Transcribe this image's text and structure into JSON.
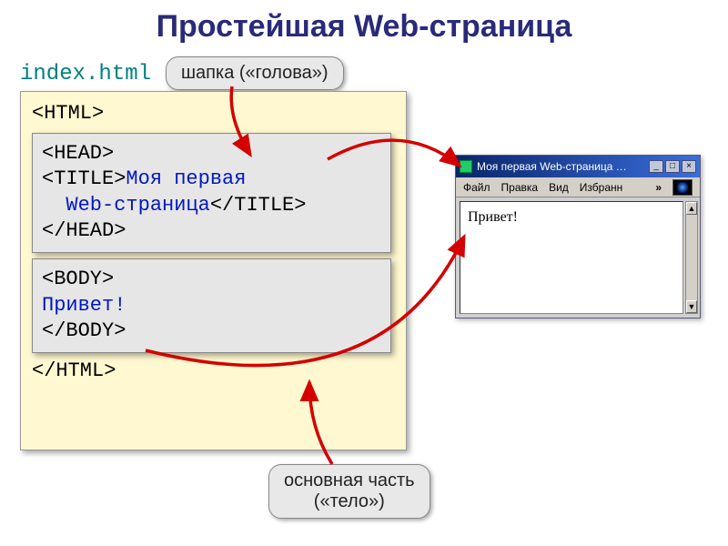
{
  "slide": {
    "title": "Простейшая Web-страница",
    "filename": "index.html"
  },
  "code": {
    "html_open": "<HTML>",
    "html_close": "</HTML>",
    "head": {
      "open": "<HEAD>",
      "title_open": "<TITLE>",
      "title_text_line1": "Моя первая",
      "title_text_line2": "Web-страница",
      "title_close": "</TITLE>",
      "close": "</HEAD>"
    },
    "body": {
      "open": "<BODY>",
      "content": "Привет!",
      "close": "</BODY>"
    }
  },
  "callouts": {
    "head_label": "шапка («голова»)",
    "body_label_line1": "основная часть",
    "body_label_line2": "(«тело»)"
  },
  "browser": {
    "window_title": "Моя первая Web-страница …",
    "menu": {
      "file": "Файл",
      "edit": "Правка",
      "view": "Вид",
      "favorites": "Избранн"
    },
    "page_text": "Привет!",
    "window_buttons": {
      "min": "_",
      "max": "□",
      "close": "×"
    },
    "chevrons": "»"
  }
}
